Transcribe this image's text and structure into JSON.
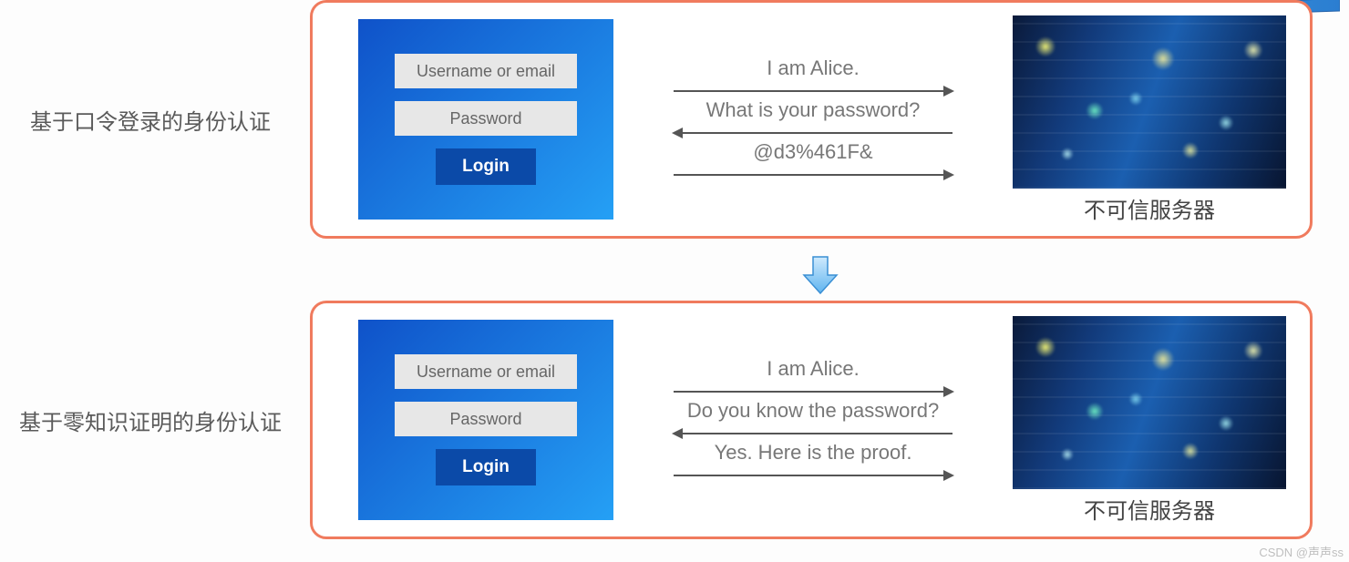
{
  "row1": {
    "label": "基于口令登录的身份认证",
    "login": {
      "username": "Username or email",
      "password": "Password",
      "button": "Login"
    },
    "messages": {
      "m1": "I am Alice.",
      "m2": "What is your password?",
      "m3": "@d3%461F&"
    },
    "server_label": "不可信服务器"
  },
  "row2": {
    "label": "基于零知识证明的身份认证",
    "login": {
      "username": "Username or email",
      "password": "Password",
      "button": "Login"
    },
    "messages": {
      "m1": "I am Alice.",
      "m2": "Do you know the password?",
      "m3": "Yes. Here is the proof."
    },
    "server_label": "不可信服务器"
  },
  "watermark": "CSDN @声声ss"
}
